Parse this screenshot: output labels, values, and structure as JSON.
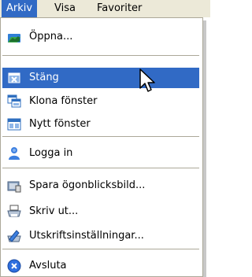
{
  "menubar": {
    "items": [
      {
        "label": "Arkiv"
      },
      {
        "label": "Visa"
      },
      {
        "label": "Favoriter"
      }
    ]
  },
  "menu": {
    "items": [
      {
        "label": "Öppna...",
        "icon": "open-folder-icon"
      },
      {
        "label": "Stäng",
        "icon": "close-icon"
      },
      {
        "label": "Klona fönster",
        "icon": "clone-window-icon"
      },
      {
        "label": "Nytt fönster",
        "icon": "new-window-icon"
      },
      {
        "label": "Logga in",
        "icon": "user-login-icon"
      },
      {
        "label": "Spara ögonblicksbild...",
        "icon": "camera-icon"
      },
      {
        "label": "Skriv ut...",
        "icon": "printer-icon"
      },
      {
        "label": "Utskriftsinställningar...",
        "icon": "print-settings-icon"
      },
      {
        "label": "Avsluta",
        "icon": "exit-icon"
      }
    ]
  },
  "colors": {
    "selection": "#316ac5",
    "menubar_bg": "#ece9d8",
    "border": "#aca899"
  }
}
